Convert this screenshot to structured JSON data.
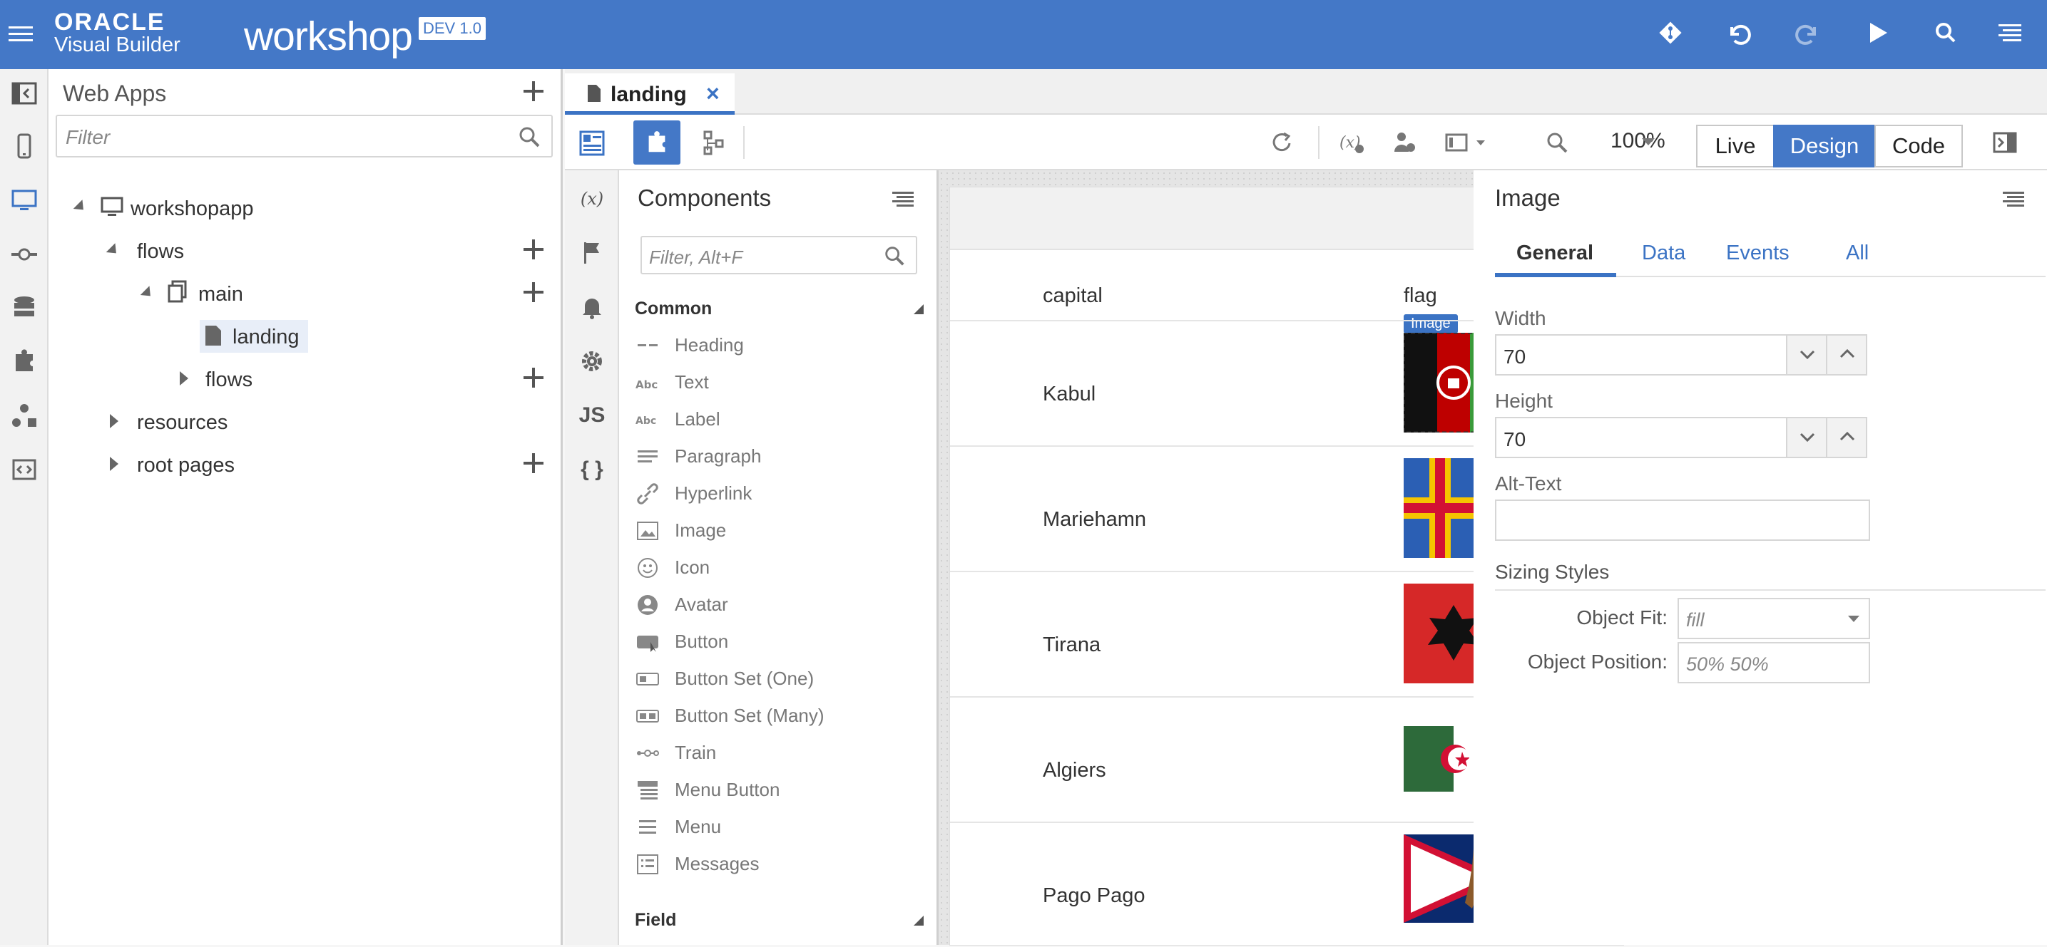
{
  "header": {
    "brand_line1": "ORACLE",
    "brand_line2": "Visual Builder",
    "app_name": "workshop",
    "version_badge": "DEV 1.0",
    "icons": [
      "git-icon",
      "undo-icon",
      "redo-icon",
      "run-icon",
      "search-icon",
      "menu-icon"
    ]
  },
  "left_rail": {
    "icons": [
      "collapse-panel-icon",
      "mobile-apps-icon",
      "web-apps-icon",
      "services-icon",
      "business-objects-icon",
      "components-icon",
      "processes-icon",
      "source-view-icon"
    ]
  },
  "navigator": {
    "title": "Web Apps",
    "filter_placeholder": "Filter",
    "tree": {
      "app": "workshopapp",
      "flows": "flows",
      "main": "main",
      "landing": "landing",
      "flows2": "flows",
      "resources": "resources",
      "root_pages": "root pages"
    }
  },
  "editor": {
    "tab": {
      "label": "landing",
      "close": "×"
    },
    "zoom": "100%",
    "modes": {
      "live": "Live",
      "design": "Design",
      "code": "Code"
    },
    "selected_mode": "Design"
  },
  "side_rail": {
    "labels": {
      "variables": "(x)",
      "js": "JS",
      "json": "{ }"
    }
  },
  "components": {
    "title": "Components",
    "filter_placeholder": "Filter, Alt+F",
    "section_common": "Common",
    "items": [
      {
        "label": "Heading",
        "icon": "heading-icon"
      },
      {
        "label": "Text",
        "icon": "text-icon"
      },
      {
        "label": "Label",
        "icon": "label-icon"
      },
      {
        "label": "Paragraph",
        "icon": "paragraph-icon"
      },
      {
        "label": "Hyperlink",
        "icon": "hyperlink-icon"
      },
      {
        "label": "Image",
        "icon": "image-icon"
      },
      {
        "label": "Icon",
        "icon": "icon-icon"
      },
      {
        "label": "Avatar",
        "icon": "avatar-icon"
      },
      {
        "label": "Button",
        "icon": "button-icon"
      },
      {
        "label": "Button Set (One)",
        "icon": "button-set-one-icon"
      },
      {
        "label": "Button Set (Many)",
        "icon": "button-set-many-icon"
      },
      {
        "label": "Train",
        "icon": "train-icon"
      },
      {
        "label": "Menu Button",
        "icon": "menu-button-icon"
      },
      {
        "label": "Menu",
        "icon": "menu-icon"
      },
      {
        "label": "Messages",
        "icon": "messages-icon"
      }
    ],
    "section_field": "Field"
  },
  "canvas": {
    "columns": {
      "capital": "capital",
      "flag": "flag"
    },
    "selected_badge": "Image",
    "rows": [
      {
        "capital": "Kabul",
        "flag": "afghanistan-flag"
      },
      {
        "capital": "Mariehamn",
        "flag": "aland-flag"
      },
      {
        "capital": "Tirana",
        "flag": "albania-flag"
      },
      {
        "capital": "Algiers",
        "flag": "algeria-flag"
      },
      {
        "capital": "Pago Pago",
        "flag": "american-samoa-flag"
      }
    ]
  },
  "properties": {
    "title": "Image",
    "tabs": [
      "General",
      "Data",
      "Events",
      "All"
    ],
    "active_tab": "General",
    "width_label": "Width",
    "width_value": "70",
    "height_label": "Height",
    "height_value": "70",
    "alt_text_label": "Alt-Text",
    "alt_text_value": "",
    "sizing_label": "Sizing Styles",
    "object_fit_label": "Object Fit:",
    "object_fit_value": "fill",
    "object_position_label": "Object Position:",
    "object_position_value": "50% 50%"
  },
  "colors": {
    "header_bg": "#4478c7",
    "accent": "#3b73c4"
  }
}
